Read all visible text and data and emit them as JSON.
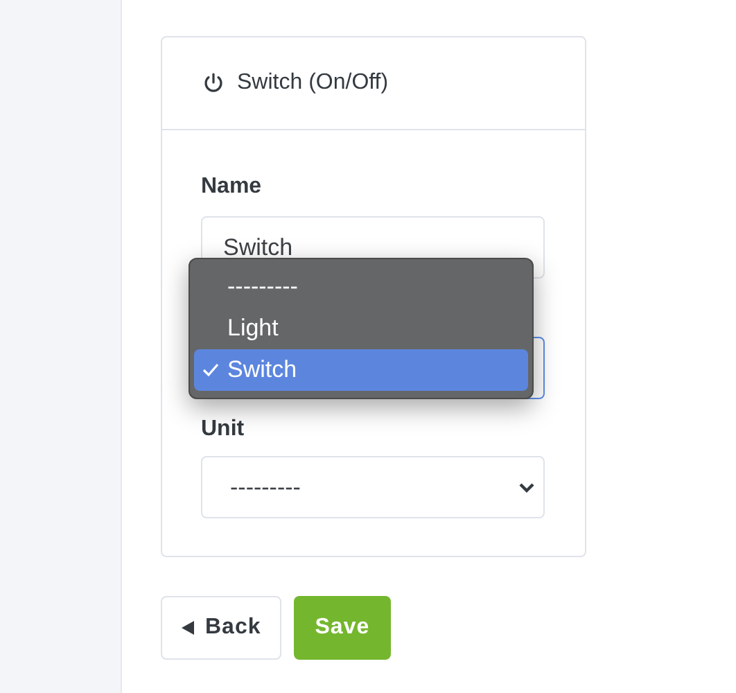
{
  "card": {
    "title": "Switch (On/Off)"
  },
  "fields": [
    {
      "kind": "text",
      "label": "Name",
      "value": "Switch"
    },
    {
      "kind": "select",
      "label": "Unit",
      "value": "---------"
    }
  ],
  "type_dropdown": {
    "options": [
      {
        "label": "---------",
        "selected": false
      },
      {
        "label": "Light",
        "selected": false
      },
      {
        "label": "Switch",
        "selected": true
      }
    ]
  },
  "buttons": [
    {
      "kind": "back",
      "label": "Back"
    },
    {
      "kind": "save",
      "label": "Save"
    }
  ]
}
